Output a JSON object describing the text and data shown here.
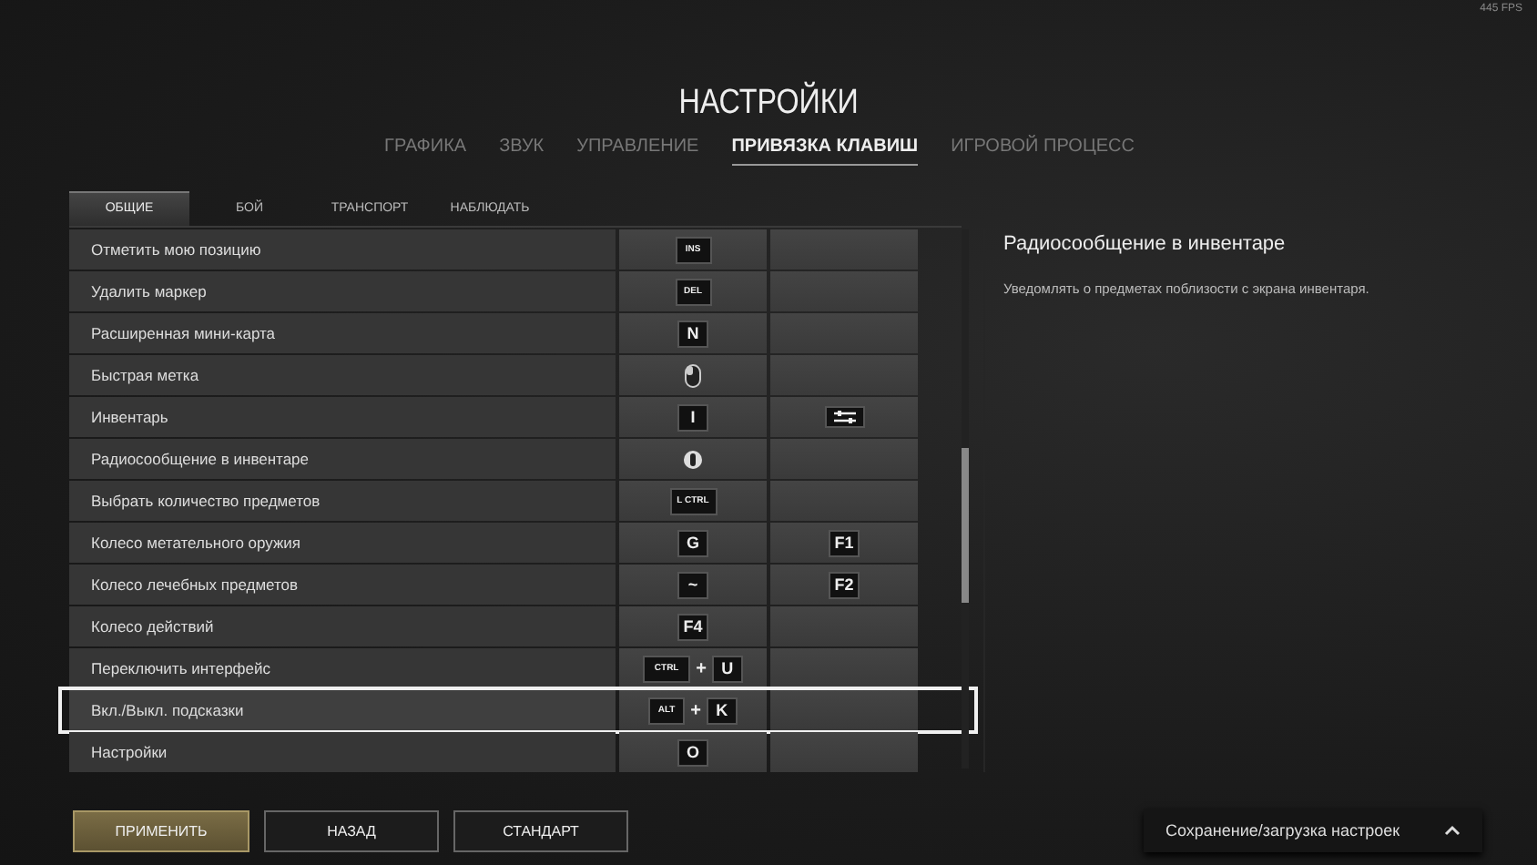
{
  "fps": "445 FPS",
  "title": "НАСТРОЙКИ",
  "tabs": [
    {
      "label": "ГРАФИКА",
      "selected": false
    },
    {
      "label": "ЗВУК",
      "selected": false
    },
    {
      "label": "УПРАВЛЕНИЕ",
      "selected": false
    },
    {
      "label": "ПРИВЯЗКА КЛАВИШ",
      "selected": true
    },
    {
      "label": "ИГРОВОЙ ПРОЦЕСС",
      "selected": false
    }
  ],
  "subtabs": [
    {
      "label": "ОБЩИЕ",
      "selected": true
    },
    {
      "label": "БОЙ",
      "selected": false
    },
    {
      "label": "ТРАНСПОРТ",
      "selected": false
    },
    {
      "label": "НАБЛЮДАТЬ",
      "selected": false
    }
  ],
  "rows": [
    {
      "label": "Отметить мою позицию",
      "selected": false,
      "primary": [
        {
          "kind": "small",
          "text": "INS"
        }
      ],
      "secondary": []
    },
    {
      "label": "Удалить маркер",
      "selected": false,
      "primary": [
        {
          "kind": "small",
          "text": "DEL"
        }
      ],
      "secondary": []
    },
    {
      "label": "Расширенная мини-карта",
      "selected": false,
      "primary": [
        {
          "kind": "key",
          "text": "N"
        }
      ],
      "secondary": []
    },
    {
      "label": "Быстрая метка",
      "selected": false,
      "primary": [
        {
          "kind": "mouse"
        }
      ],
      "secondary": []
    },
    {
      "label": "Инвентарь",
      "selected": false,
      "primary": [
        {
          "kind": "key",
          "text": "I"
        }
      ],
      "secondary": [
        {
          "kind": "sliders"
        }
      ]
    },
    {
      "label": "Радиосообщение в инвентаре",
      "selected": false,
      "primary": [
        {
          "kind": "wheel"
        }
      ],
      "secondary": []
    },
    {
      "label": "Выбрать количество предметов",
      "selected": false,
      "primary": [
        {
          "kind": "small",
          "text": "L CTRL"
        }
      ],
      "secondary": []
    },
    {
      "label": "Колесо метательного оружия",
      "selected": false,
      "primary": [
        {
          "kind": "key",
          "text": "G"
        }
      ],
      "secondary": [
        {
          "kind": "key",
          "text": "F1"
        }
      ]
    },
    {
      "label": "Колесо лечебных предметов",
      "selected": false,
      "primary": [
        {
          "kind": "key",
          "text": "~"
        }
      ],
      "secondary": [
        {
          "kind": "key",
          "text": "F2"
        }
      ]
    },
    {
      "label": "Колесо действий",
      "selected": false,
      "primary": [
        {
          "kind": "key",
          "text": "F4"
        }
      ],
      "secondary": []
    },
    {
      "label": "Переключить интерфейс",
      "selected": false,
      "primary": [
        {
          "kind": "small",
          "text": "CTRL"
        },
        {
          "kind": "plus",
          "text": "+"
        },
        {
          "kind": "key",
          "text": "U"
        }
      ],
      "secondary": []
    },
    {
      "label": "Вкл./Выкл. подсказки",
      "selected": true,
      "primary": [
        {
          "kind": "small",
          "text": "ALT"
        },
        {
          "kind": "plus",
          "text": "+"
        },
        {
          "kind": "key",
          "text": "K"
        }
      ],
      "secondary": []
    },
    {
      "label": "Настройки",
      "selected": false,
      "primary": [
        {
          "kind": "key",
          "text": "O"
        }
      ],
      "secondary": []
    }
  ],
  "detail": {
    "title": "Радиосообщение в инвентаре",
    "description": "Уведомлять о предметах поблизости с экрана инвентаря."
  },
  "buttons": [
    {
      "label": "ПРИМЕНИТЬ",
      "primary": true
    },
    {
      "label": "НАЗАД",
      "primary": false
    },
    {
      "label": "СТАНДАРТ",
      "primary": false
    }
  ],
  "save_load": {
    "label": "Сохранение/загрузка настроек"
  }
}
